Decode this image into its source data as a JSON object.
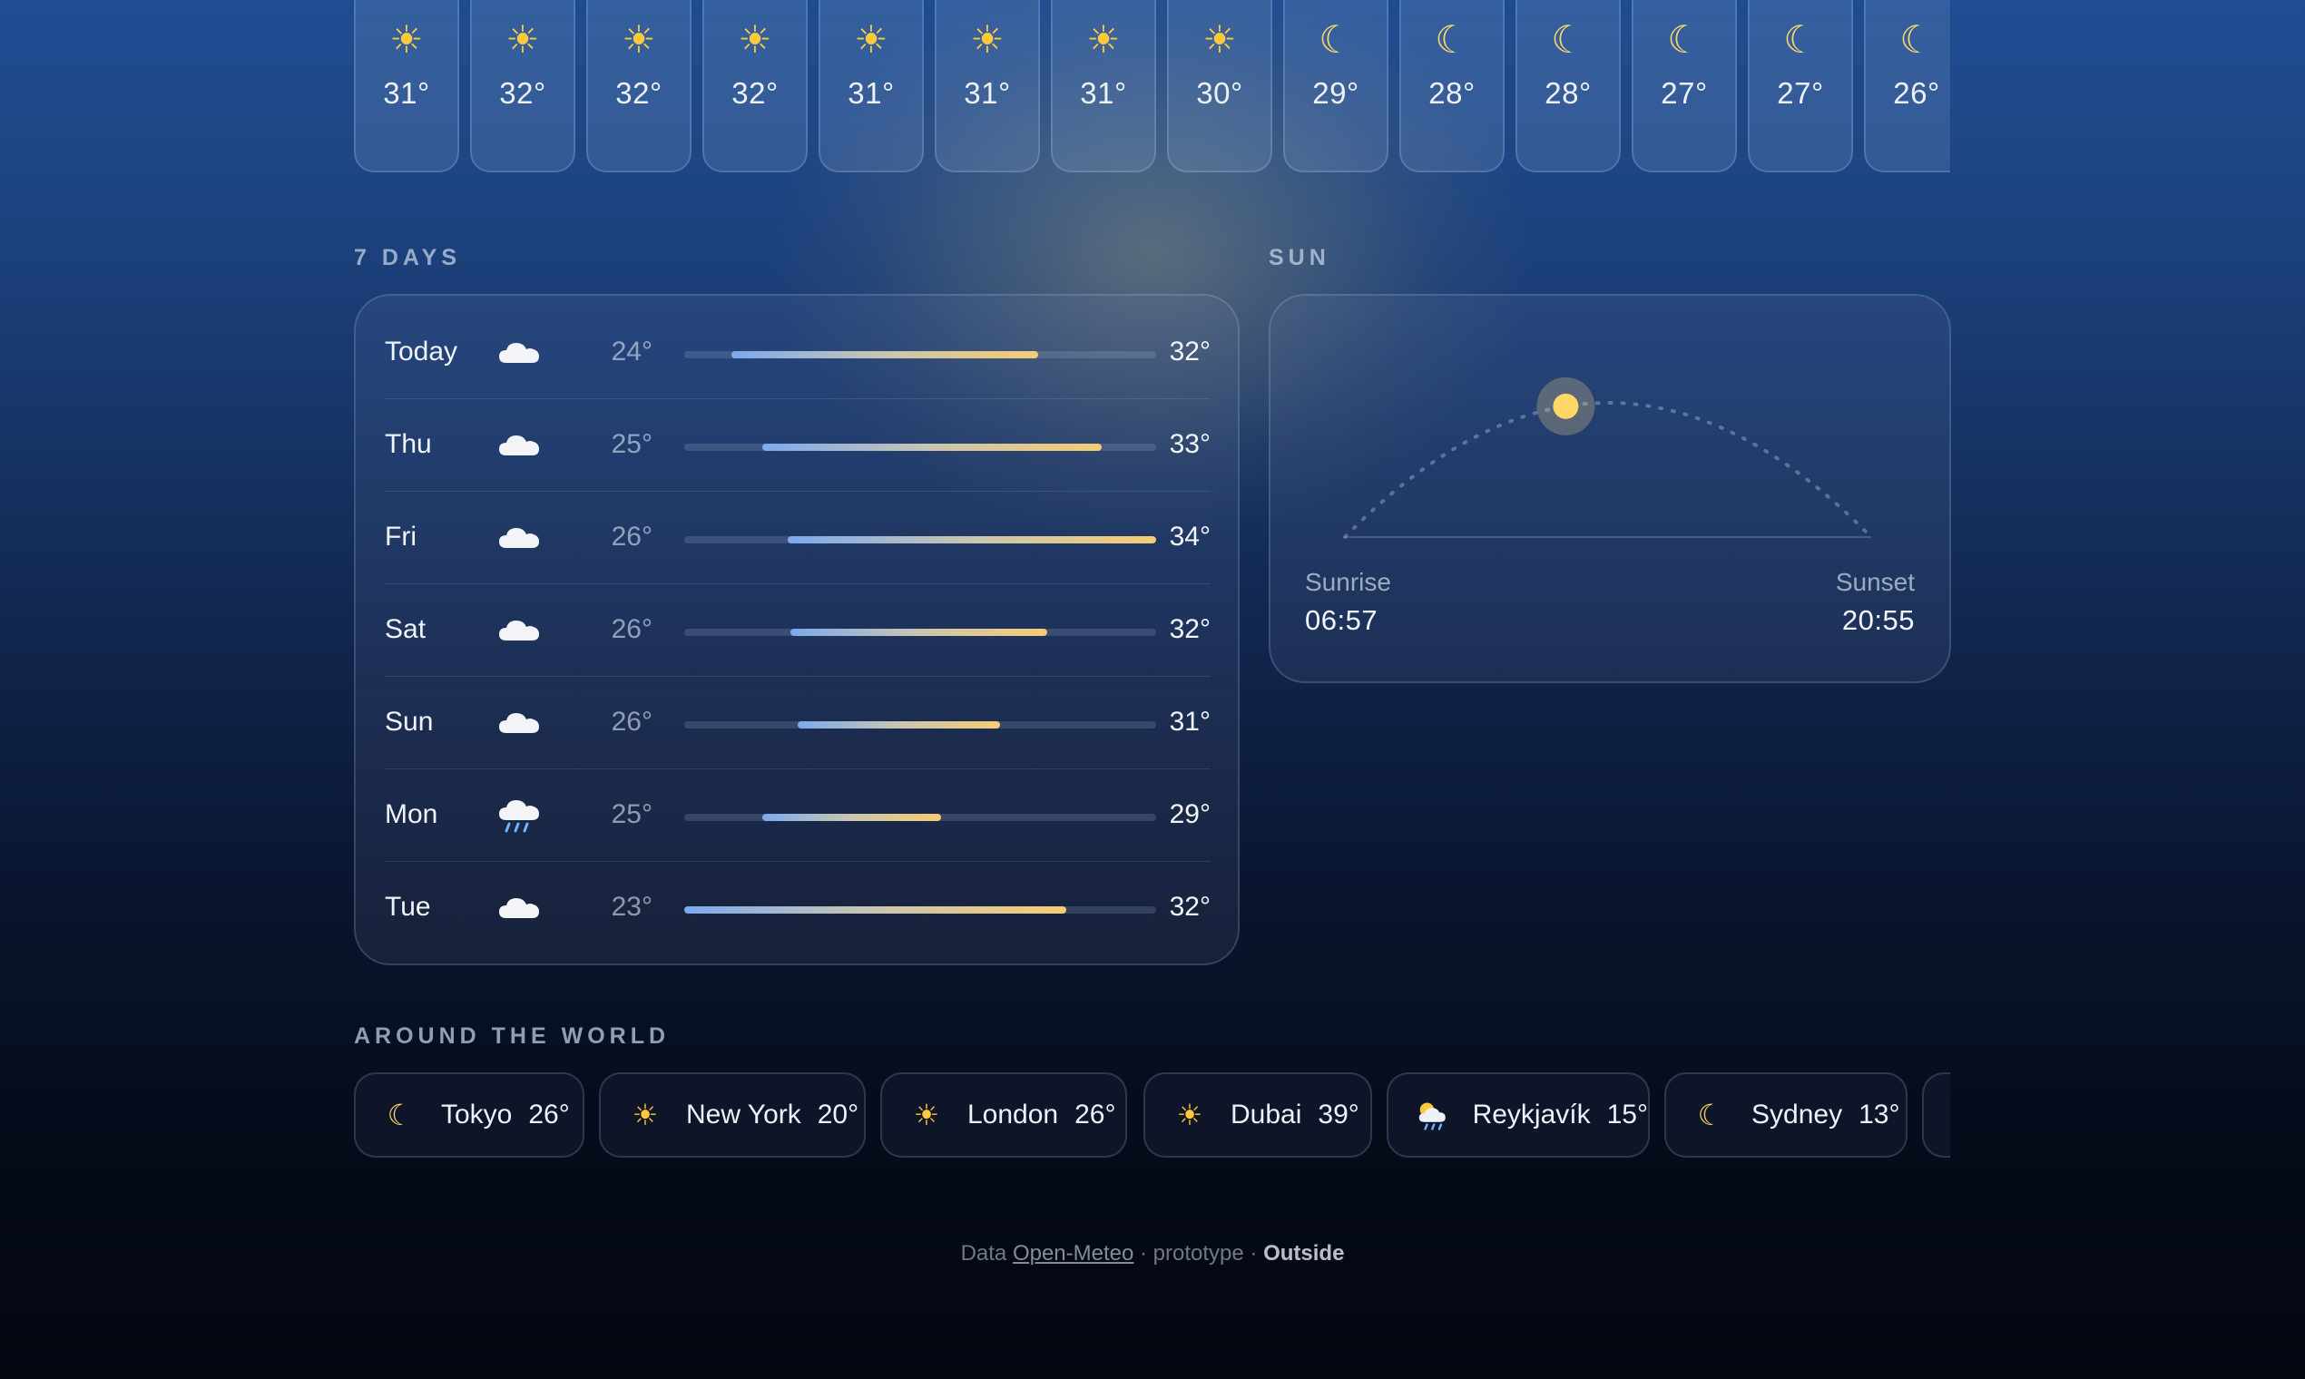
{
  "hourly": [
    {
      "icon": "sun-icon",
      "temp": "31°"
    },
    {
      "icon": "sun-icon",
      "temp": "32°"
    },
    {
      "icon": "sun-icon",
      "temp": "32°"
    },
    {
      "icon": "sun-icon",
      "temp": "32°"
    },
    {
      "icon": "sun-icon",
      "temp": "31°"
    },
    {
      "icon": "sun-icon",
      "temp": "31°"
    },
    {
      "icon": "sun-icon",
      "temp": "31°"
    },
    {
      "icon": "sun-icon",
      "temp": "30°"
    },
    {
      "icon": "moon-icon",
      "temp": "29°"
    },
    {
      "icon": "moon-icon",
      "temp": "28°"
    },
    {
      "icon": "moon-icon",
      "temp": "28°"
    },
    {
      "icon": "moon-icon",
      "temp": "27°"
    },
    {
      "icon": "moon-icon",
      "temp": "27°"
    },
    {
      "icon": "moon-icon",
      "temp": "26°"
    }
  ],
  "seven_days": {
    "title": "7 DAYS",
    "days": [
      {
        "name": "Today",
        "icon": "cloud-icon",
        "min": "24°",
        "max": "32°"
      },
      {
        "name": "Thu",
        "icon": "cloud-icon",
        "min": "25°",
        "max": "33°"
      },
      {
        "name": "Fri",
        "icon": "cloud-icon",
        "min": "26°",
        "max": "34°"
      },
      {
        "name": "Sat",
        "icon": "cloud-icon",
        "min": "26°",
        "max": "32°"
      },
      {
        "name": "Sun",
        "icon": "cloud-icon",
        "min": "26°",
        "max": "31°"
      },
      {
        "name": "Mon",
        "icon": "rain-cloud-icon",
        "min": "25°",
        "max": "29°"
      },
      {
        "name": "Tue",
        "icon": "cloud-icon",
        "min": "23°",
        "max": "32°"
      }
    ],
    "range_bars": [
      {
        "start": 0.1,
        "end": 0.75
      },
      {
        "start": 0.165,
        "end": 0.885
      },
      {
        "start": 0.22,
        "end": 1.0
      },
      {
        "start": 0.225,
        "end": 0.77
      },
      {
        "start": 0.24,
        "end": 0.67
      },
      {
        "start": 0.165,
        "end": 0.545
      },
      {
        "start": 0.0,
        "end": 0.81
      }
    ]
  },
  "sun": {
    "title": "SUN",
    "sunrise_label": "Sunrise",
    "sunrise_time": "06:57",
    "sunset_label": "Sunset",
    "sunset_time": "20:55",
    "day_progress": 0.43
  },
  "world": {
    "title": "AROUND THE WORLD",
    "cities": [
      {
        "icon": "moon-icon",
        "city": "Tokyo",
        "temp": "26°"
      },
      {
        "icon": "sun-icon",
        "city": "New York",
        "temp": "20°"
      },
      {
        "icon": "sun-icon",
        "city": "London",
        "temp": "26°"
      },
      {
        "icon": "sun-icon",
        "city": "Dubai",
        "temp": "39°"
      },
      {
        "icon": "sun-behind-rain-cloud-icon",
        "city": "Reykjavík",
        "temp": "15°"
      },
      {
        "icon": "moon-icon",
        "city": "Sydney",
        "temp": "13°"
      }
    ]
  },
  "footer": {
    "data_label": "Data",
    "source_link": "Open-Meteo",
    "middle": "· prototype ·",
    "brand": "Outside"
  },
  "colors": {
    "bar_cold": "#7ea9ee",
    "bar_warm": "#f6cc72",
    "sun": "#ffd766"
  }
}
